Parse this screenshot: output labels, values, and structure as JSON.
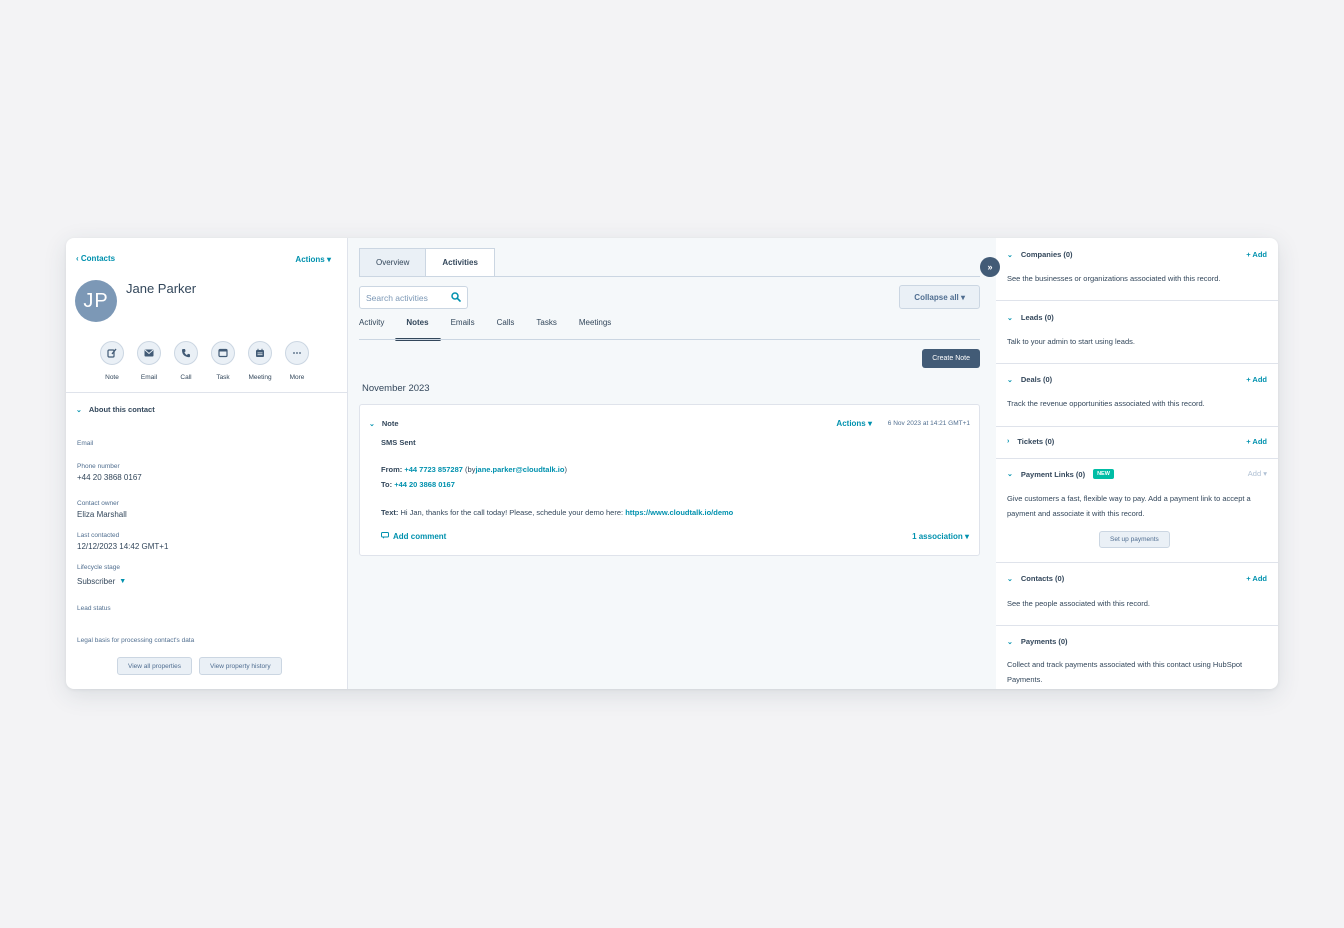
{
  "left": {
    "back_label": "‹ Contacts",
    "actions_label": "Actions ▾",
    "avatar_initials": "JP",
    "contact_name": "Jane Parker",
    "quick_actions": [
      {
        "label": "Note",
        "icon": "note-icon"
      },
      {
        "label": "Email",
        "icon": "email-icon"
      },
      {
        "label": "Call",
        "icon": "call-icon"
      },
      {
        "label": "Task",
        "icon": "task-icon"
      },
      {
        "label": "Meeting",
        "icon": "meeting-icon"
      },
      {
        "label": "More",
        "icon": "more-icon"
      }
    ],
    "about_title": "About this contact",
    "properties": {
      "email_label": "Email",
      "phone_label": "Phone number",
      "phone_value": "+44 20 3868 0167",
      "owner_label": "Contact owner",
      "owner_value": "Eliza Marshall",
      "last_contacted_label": "Last contacted",
      "last_contacted_value": "12/12/2023 14:42 GMT+1",
      "lifecycle_label": "Lifecycle stage",
      "lifecycle_value": "Subscriber",
      "lead_status_label": "Lead status",
      "legal_basis_label": "Legal basis for processing contact's data"
    },
    "view_all_label": "View all properties",
    "view_history_label": "View property history"
  },
  "middle": {
    "tabs": [
      "Overview",
      "Activities"
    ],
    "active_tab": "Activities",
    "search_placeholder": "Search activities",
    "collapse_label": "Collapse all ▾",
    "subtabs": [
      "Activity",
      "Notes",
      "Emails",
      "Calls",
      "Tasks",
      "Meetings"
    ],
    "active_subtab": "Notes",
    "create_note_label": "Create Note",
    "month": "November 2023",
    "note": {
      "type": "Note",
      "actions": "Actions ▾",
      "timestamp": "6 Nov 2023 at 14:21 GMT+1",
      "title": "SMS Sent",
      "from_label": "From:",
      "from_number": "+44 7723 857287",
      "by_prefix": "(by",
      "by_email": "jane.parker@cloudtalk.io",
      "by_suffix": ")",
      "to_label": "To:",
      "to_number": "+44 20 3868 0167",
      "text_label": "Text:",
      "text_body": "Hi Jan, thanks for the call today! Please, schedule your demo here:",
      "text_link": "https://www.cloudtalk.io/demo",
      "add_comment": "Add comment",
      "association": "1 association ▾"
    }
  },
  "right": {
    "sections": [
      {
        "title": "Companies (0)",
        "add": "+ Add",
        "desc": "See the businesses or organizations associated with this record."
      },
      {
        "title": "Leads (0)",
        "add": "",
        "desc": "Talk to your admin to start using leads."
      },
      {
        "title": "Deals (0)",
        "add": "+ Add",
        "desc": "Track the revenue opportunities associated with this record."
      },
      {
        "title": "Tickets (0)",
        "add": "+ Add",
        "desc": ""
      },
      {
        "title": "Payment Links (0)",
        "badge": "NEW",
        "add": "Add ▾",
        "desc": "Give customers a fast, flexible way to pay. Add a payment link to accept a payment and associate it with this record.",
        "button": "Set up payments"
      },
      {
        "title": "Contacts (0)",
        "add": "+ Add",
        "desc": "See the people associated with this record."
      },
      {
        "title": "Payments (0)",
        "add": "",
        "desc": "Collect and track payments associated with this contact using HubSpot Payments."
      }
    ]
  },
  "colors": {
    "accent": "#0091ae",
    "primary_dark": "#425b76",
    "text": "#33475b",
    "badge_new": "#00bda5",
    "avatar": "#7c98b6"
  }
}
